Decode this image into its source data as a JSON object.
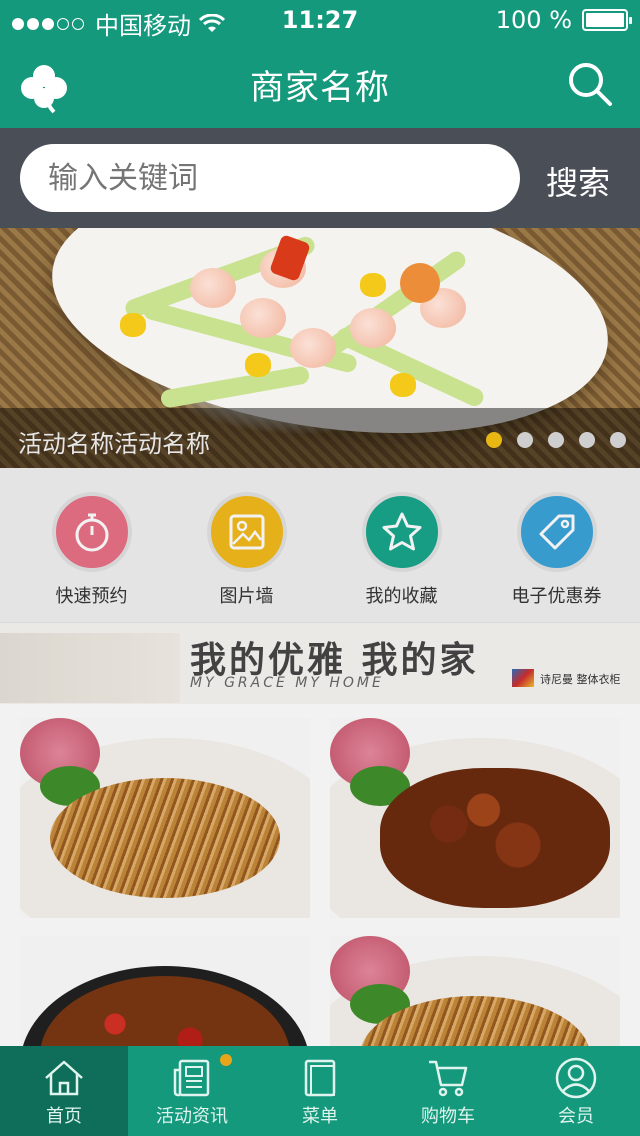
{
  "status_bar": {
    "carrier": "中国移动",
    "time": "11:27",
    "battery": "100 %"
  },
  "header": {
    "title": "商家名称",
    "logo_icon": "clover-icon",
    "search_icon": "search-icon"
  },
  "search": {
    "placeholder": "输入关键词",
    "button_label": "搜索"
  },
  "banner": {
    "caption": "活动名称活动名称",
    "page_count": 5,
    "active_index": 0
  },
  "shortcuts": [
    {
      "label": "快速预约",
      "icon": "stopwatch-icon",
      "color": "#e87085"
    },
    {
      "label": "图片墙",
      "icon": "picture-icon",
      "color": "#f2b91a"
    },
    {
      "label": "我的收藏",
      "icon": "star-icon",
      "color": "#16a58a"
    },
    {
      "label": "电子优惠券",
      "icon": "tag-icon",
      "color": "#3aa3d9"
    }
  ],
  "ad": {
    "headline": "我的优雅 我的家",
    "subline": "MY GRACE MY HOME",
    "brand": "诗尼曼 整体衣柜"
  },
  "tabbar": {
    "items": [
      {
        "label": "首页",
        "icon": "home-icon",
        "active": true
      },
      {
        "label": "活动资讯",
        "icon": "news-icon",
        "badge": true
      },
      {
        "label": "菜单",
        "icon": "menu-book-icon"
      },
      {
        "label": "购物车",
        "icon": "cart-icon"
      },
      {
        "label": "会员",
        "icon": "user-icon"
      }
    ]
  },
  "colors": {
    "primary": "#15997c",
    "primary_dark": "#0e6e59",
    "search_bar_bg": "#4a4f57",
    "pager_active": "#e8b714"
  }
}
